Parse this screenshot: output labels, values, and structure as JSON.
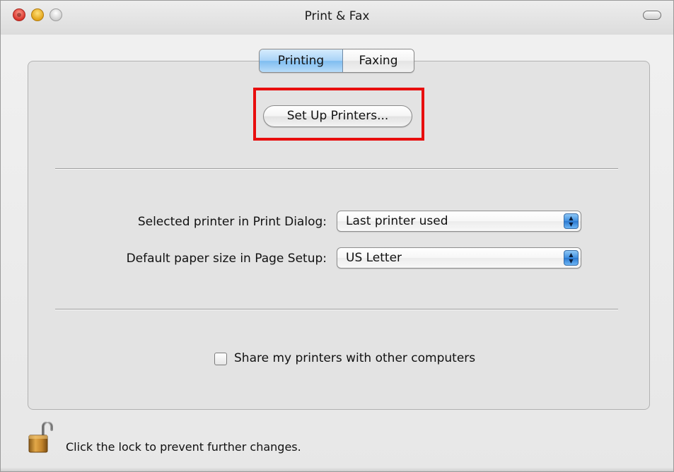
{
  "window": {
    "title": "Print & Fax"
  },
  "tabs": [
    {
      "label": "Printing",
      "selected": true
    },
    {
      "label": "Faxing",
      "selected": false
    }
  ],
  "printing": {
    "setup_button_label": "Set Up Printers...",
    "selected_printer": {
      "label": "Selected printer in Print Dialog:",
      "value": "Last printer used"
    },
    "paper_size": {
      "label": "Default paper size in Page Setup:",
      "value": "US Letter"
    },
    "share": {
      "label": "Share my printers with other computers",
      "checked": false
    }
  },
  "footer": {
    "lock_text": "Click the lock to prevent further changes."
  },
  "colors": {
    "highlight": "#e80e0e",
    "tab_selected": "#a9d3f7"
  },
  "icons": {
    "popup_arrows": "up-down-arrows-icon",
    "lock": "lock-open-icon"
  }
}
